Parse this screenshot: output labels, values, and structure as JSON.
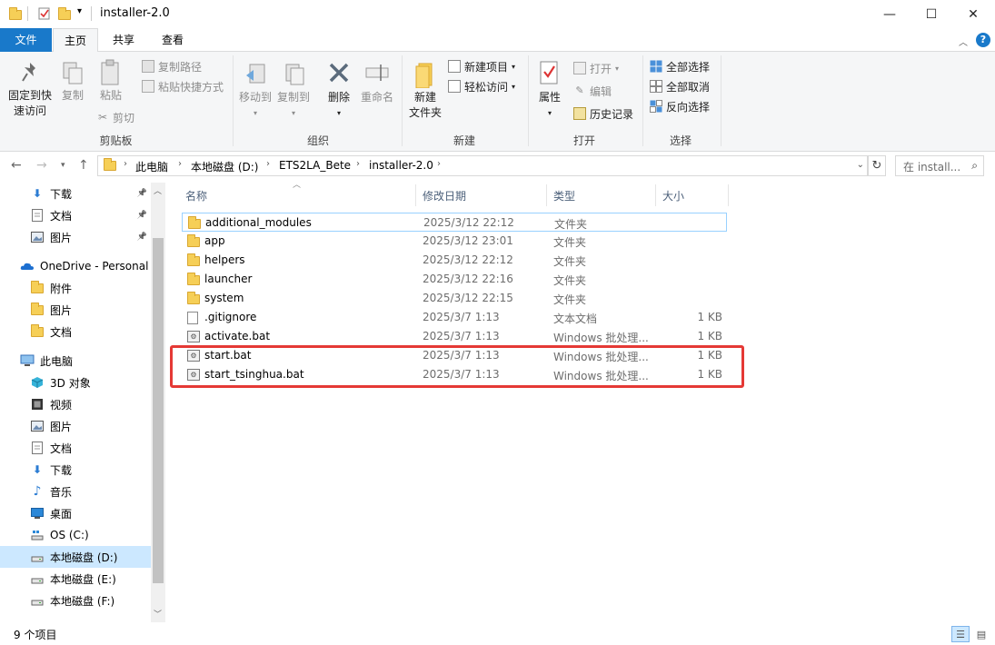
{
  "window": {
    "title": "installer-2.0",
    "controls": [
      "—",
      "☐",
      "✕"
    ]
  },
  "ribbon_tabs": [
    "文件",
    "主页",
    "共享",
    "查看"
  ],
  "ribbon": {
    "clipboard": {
      "pin_label_1": "固定到快",
      "pin_label_2": "速访问",
      "copy": "复制",
      "paste": "粘贴",
      "copy_path": "复制路径",
      "paste_shortcut": "粘贴快捷方式",
      "cut": "剪切",
      "group": "剪贴板"
    },
    "organize": {
      "move_to": "移动到",
      "copy_to": "复制到",
      "delete": "删除",
      "rename": "重命名",
      "group": "组织"
    },
    "new": {
      "new_folder_1": "新建",
      "new_folder_2": "文件夹",
      "new_item": "新建项目",
      "easy_access": "轻松访问",
      "group": "新建"
    },
    "open": {
      "properties": "属性",
      "open": "打开",
      "edit": "编辑",
      "history": "历史记录",
      "group": "打开"
    },
    "select": {
      "select_all": "全部选择",
      "select_none": "全部取消",
      "invert": "反向选择",
      "group": "选择"
    }
  },
  "address": {
    "crumbs": [
      "此电脑",
      "本地磁盘 (D:)",
      "ETS2LA_Bete",
      "installer-2.0"
    ],
    "search_placeholder": "在 install..."
  },
  "nav": {
    "quick": [
      {
        "label": "下载",
        "icon": "download-icon",
        "pinned": true
      },
      {
        "label": "文档",
        "icon": "document-icon",
        "pinned": true
      },
      {
        "label": "图片",
        "icon": "picture-icon",
        "pinned": true
      }
    ],
    "onedrive": {
      "label": "OneDrive - Personal"
    },
    "onedrive_items": [
      "附件",
      "图片",
      "文档"
    ],
    "this_pc": {
      "label": "此电脑"
    },
    "pc_items": [
      {
        "label": "3D 对象",
        "icon": "3d-objects-icon"
      },
      {
        "label": "视频",
        "icon": "video-icon"
      },
      {
        "label": "图片",
        "icon": "picture-icon"
      },
      {
        "label": "文档",
        "icon": "document-icon"
      },
      {
        "label": "下载",
        "icon": "download-icon"
      },
      {
        "label": "音乐",
        "icon": "music-icon"
      },
      {
        "label": "桌面",
        "icon": "desktop-icon"
      },
      {
        "label": "OS (C:)",
        "icon": "os-drive-icon"
      },
      {
        "label": "本地磁盘 (D:)",
        "icon": "drive-icon",
        "selected": true
      },
      {
        "label": "本地磁盘 (E:)",
        "icon": "drive-icon"
      },
      {
        "label": "本地磁盘 (F:)",
        "icon": "drive-icon"
      }
    ]
  },
  "columns": {
    "name": "名称",
    "date": "修改日期",
    "type": "类型",
    "size": "大小"
  },
  "files": [
    {
      "name": "additional_modules",
      "date": "2025/3/12 22:12",
      "type": "文件夹",
      "size": "",
      "kind": "folder"
    },
    {
      "name": "app",
      "date": "2025/3/12 23:01",
      "type": "文件夹",
      "size": "",
      "kind": "folder"
    },
    {
      "name": "helpers",
      "date": "2025/3/12 22:12",
      "type": "文件夹",
      "size": "",
      "kind": "folder"
    },
    {
      "name": "launcher",
      "date": "2025/3/12 22:16",
      "type": "文件夹",
      "size": "",
      "kind": "folder"
    },
    {
      "name": "system",
      "date": "2025/3/12 22:15",
      "type": "文件夹",
      "size": "",
      "kind": "folder"
    },
    {
      "name": ".gitignore",
      "date": "2025/3/7 1:13",
      "type": "文本文档",
      "size": "1 KB",
      "kind": "text"
    },
    {
      "name": "activate.bat",
      "date": "2025/3/7 1:13",
      "type": "Windows 批处理...",
      "size": "1 KB",
      "kind": "bat"
    },
    {
      "name": "start.bat",
      "date": "2025/3/7 1:13",
      "type": "Windows 批处理...",
      "size": "1 KB",
      "kind": "bat"
    },
    {
      "name": "start_tsinghua.bat",
      "date": "2025/3/7 1:13",
      "type": "Windows 批处理...",
      "size": "1 KB",
      "kind": "bat"
    }
  ],
  "status": {
    "item_count": "9 个项目"
  },
  "colors": {
    "file_tab": "#1979ca",
    "selection": "#cce8ff",
    "highlight": "#e53935",
    "folder": "#f6cf57"
  }
}
